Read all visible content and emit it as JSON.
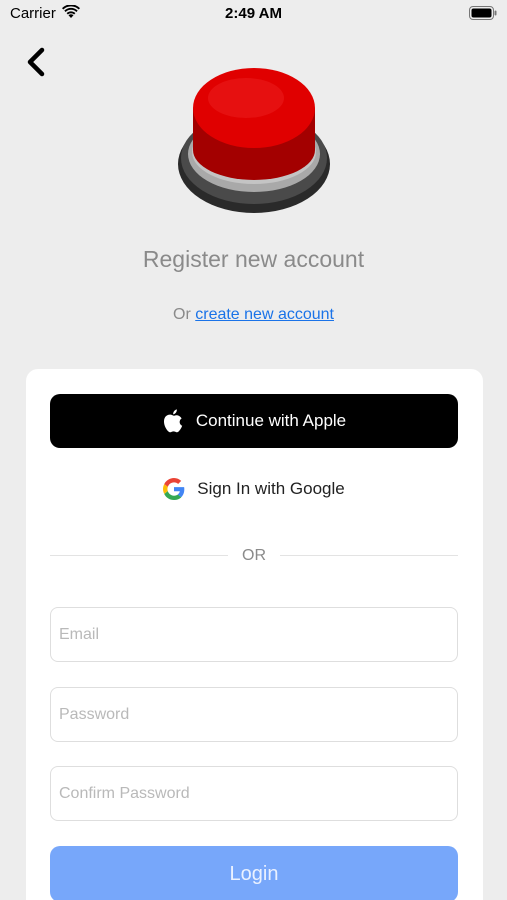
{
  "status_bar": {
    "carrier": "Carrier",
    "time": "2:49 AM"
  },
  "header": {
    "back_icon": "chevron-left-icon",
    "logo_icon": "red-button-icon",
    "title": "Register new account",
    "subtitle_prefix": "Or",
    "subtitle_link": "create new account"
  },
  "auth": {
    "apple_label": "Continue with Apple",
    "google_label": "Sign In with Google",
    "divider_label": "OR"
  },
  "form": {
    "email_placeholder": "Email",
    "password_placeholder": "Password",
    "confirm_placeholder": "Confirm Password",
    "login_label": "Login"
  },
  "colors": {
    "background": "#ededed",
    "link": "#1a73e8",
    "login_button": "#77a7fa",
    "apple_button": "#000000",
    "logo_red": "#e00000"
  }
}
